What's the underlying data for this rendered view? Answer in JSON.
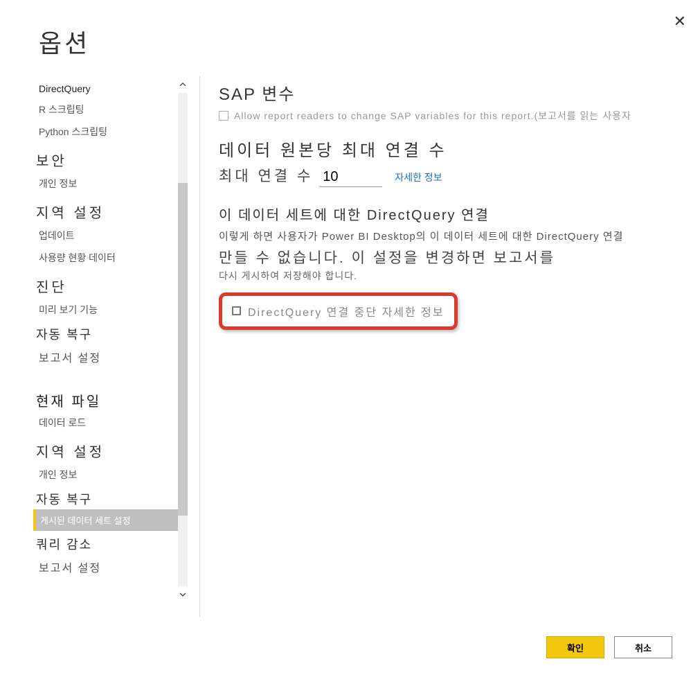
{
  "dialog": {
    "title": "옵션",
    "close_icon": "✕"
  },
  "sidebar": {
    "items": [
      {
        "label": "DirectQuery",
        "type": "bold"
      },
      {
        "label": "R 스크립팅",
        "type": "item"
      },
      {
        "label": "Python 스크립팅",
        "type": "item"
      },
      {
        "label": "보안",
        "type": "heading"
      },
      {
        "label": "개인 정보",
        "type": "item"
      },
      {
        "label": "지역 설정",
        "type": "heading"
      },
      {
        "label": "업데이트",
        "type": "item"
      },
      {
        "label": "사용량 현황 데이터",
        "type": "item"
      },
      {
        "label": "진단",
        "type": "heading"
      },
      {
        "label": "미리 보기 기능",
        "type": "item"
      },
      {
        "label": "자동 복구",
        "type": "section"
      },
      {
        "label": "보고서 설정",
        "type": "item"
      },
      {
        "label": "현재 파일",
        "type": "section-major"
      },
      {
        "label": "데이터 로드",
        "type": "item"
      },
      {
        "label": "지역 설정",
        "type": "heading"
      },
      {
        "label": "개인 정보",
        "type": "item"
      },
      {
        "label": "자동 복구",
        "type": "section"
      },
      {
        "label": "게시된 데이터 세트 설정",
        "type": "selected"
      },
      {
        "label": "쿼리 감소",
        "type": "section"
      },
      {
        "label": "보고서 설정",
        "type": "item"
      }
    ]
  },
  "main": {
    "sap": {
      "title": "SAP 변수",
      "checkbox_label": "Allow report readers to change SAP variables for this report.(보고서를 읽는 사용자"
    },
    "max_conn": {
      "title": "데이터 원본당 최대 연결 수",
      "label": "최대 연결 수",
      "value": "10",
      "link": "자세한 정보"
    },
    "dq": {
      "title": "이 데이터 세트에 대한 DirectQuery 연결",
      "desc1": "이렇게 하면 사용자가 Power BI Desktop의 이 데이터 세트에 대한 DirectQuery 연결",
      "desc2": "만들 수 없습니다. 이 설정을 변경하면 보고서를",
      "desc3": "다시 게시하여 저장해야 합니다.",
      "highlight_label": "DirectQuery 연결 중단 자세한 정보"
    }
  },
  "footer": {
    "ok": "확인",
    "cancel": "취소"
  }
}
